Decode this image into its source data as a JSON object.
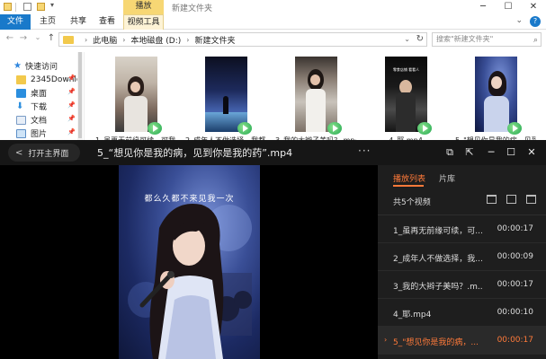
{
  "explorer": {
    "ribbon_context_label": "播放",
    "window_title": "新建文件夹",
    "ribbon_tabs": [
      "文件",
      "主页",
      "共享",
      "查看",
      "视频工具"
    ],
    "breadcrumb": [
      "此电脑",
      "本地磁盘 (D:)",
      "新建文件夹"
    ],
    "search_placeholder": "搜索\"新建文件夹\"",
    "nav_items": [
      {
        "label": "快速访问",
        "icon": "star-icon"
      },
      {
        "label": "2345Downlc",
        "icon": "folder-icon"
      },
      {
        "label": "桌面",
        "icon": "desktop-icon"
      },
      {
        "label": "下载",
        "icon": "download-icon"
      },
      {
        "label": "文档",
        "icon": "document-icon"
      },
      {
        "label": "图片",
        "icon": "picture-icon"
      }
    ],
    "files": [
      "1_虽再无前缘可续，可我...",
      "2_成年人不做选择，我都...",
      "3_我的大辫子美吗？.mp4",
      "4_耶.mp4",
      "5_\"想见你是我的病，见到..."
    ],
    "thumb_caption": "零食店铺 看看人"
  },
  "player": {
    "home_label": "打开主界面",
    "now_playing": "5_“想见你是我的病，见到你是我的药”.mp4",
    "subtitle": "都么久都不来见我一次",
    "tabs": [
      "播放列表",
      "片库"
    ],
    "count_label": "共5个视频",
    "playlist": [
      {
        "name": "1_虽再无前缘可续，可...",
        "duration": "00:00:17",
        "active": false
      },
      {
        "name": "2_成年人不做选择，我...",
        "duration": "00:00:09",
        "active": false
      },
      {
        "name": "3_我的大辫子美吗？.m...",
        "duration": "00:00:17",
        "active": false
      },
      {
        "name": "4_耶.mp4",
        "duration": "00:00:10",
        "active": false
      },
      {
        "name": "5_\"想见你是我的病，...",
        "duration": "00:00:17",
        "active": true
      }
    ],
    "colors": {
      "accent": "#ff7a3a",
      "background": "#0b0b0b",
      "panel": "#1e1e1e"
    }
  }
}
